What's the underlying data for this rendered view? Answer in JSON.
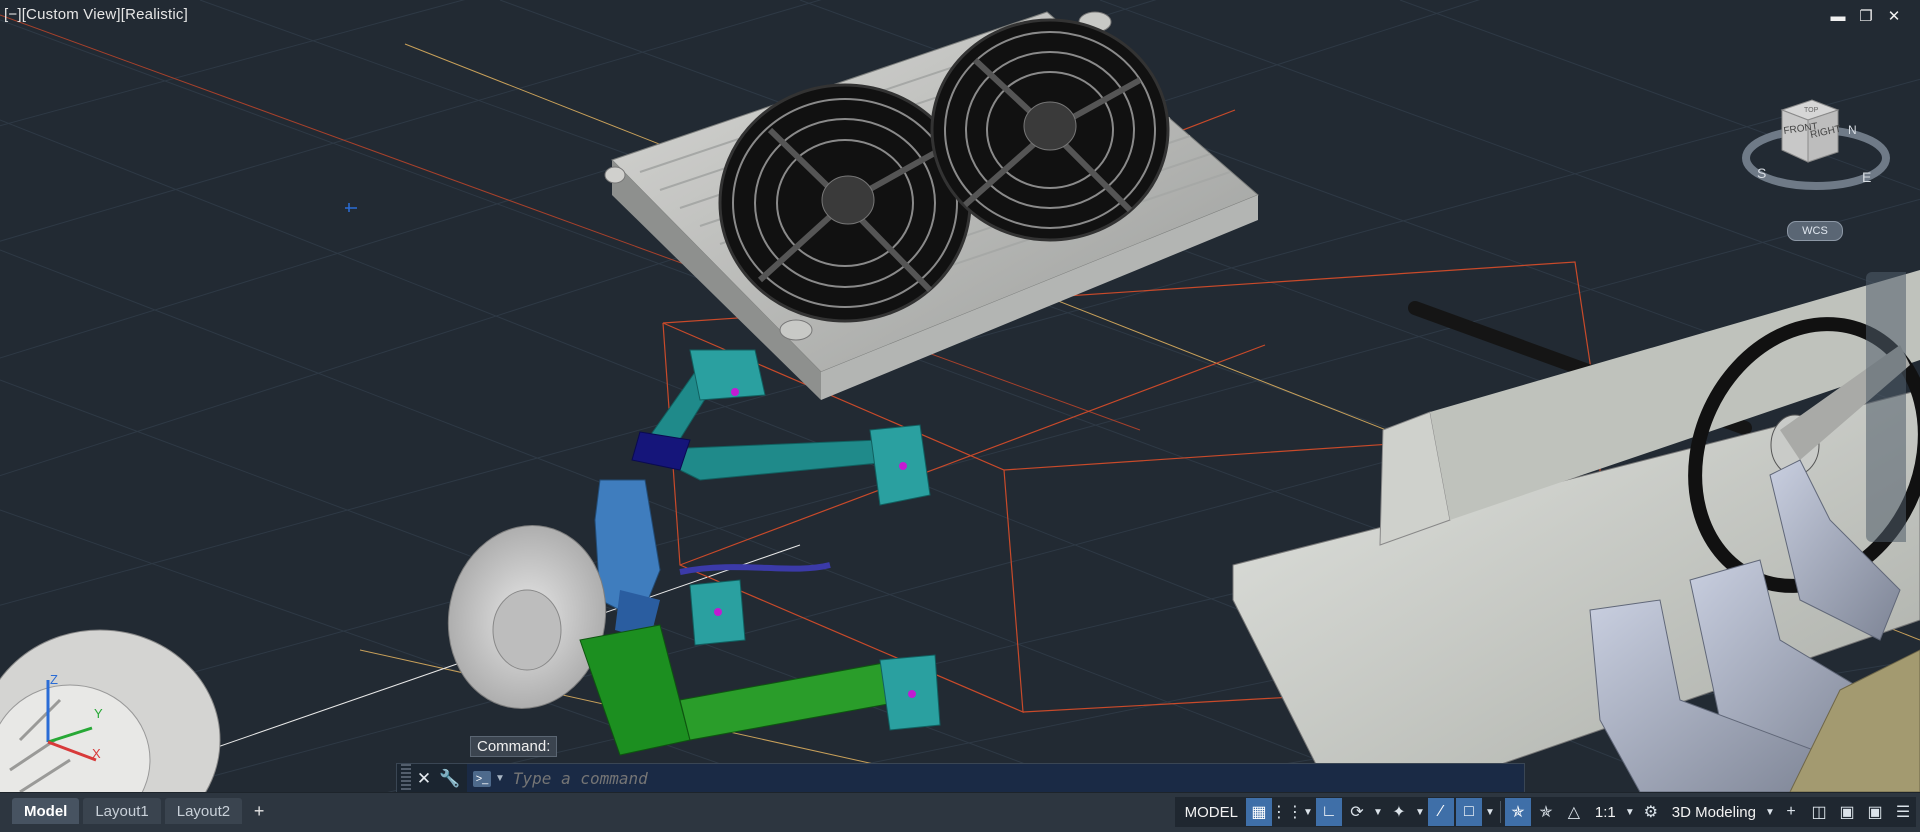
{
  "viewport": {
    "view_label": "[−][Custom View][Realistic]",
    "wcs_label": "WCS"
  },
  "viewcube": {
    "front": "FRONT",
    "right": "RIGHT",
    "top": "TOP",
    "compass_s": "S",
    "compass_e": "E",
    "compass_n": "N"
  },
  "ucs_axes": {
    "x": "X",
    "y": "Y",
    "z": "Z"
  },
  "command": {
    "history": "Command:",
    "placeholder": "Type a command"
  },
  "tabs": [
    {
      "label": "Model",
      "active": true
    },
    {
      "label": "Layout1",
      "active": false
    },
    {
      "label": "Layout2",
      "active": false
    }
  ],
  "status": {
    "model_label": "MODEL",
    "scale_label": "1:1",
    "workspace_label": "3D Modeling"
  },
  "colors": {
    "viewport_bg": "#222a33",
    "grid": "#2e3945",
    "accent_on": "#3f6fa8",
    "boundary_red": "#c94a2a"
  }
}
